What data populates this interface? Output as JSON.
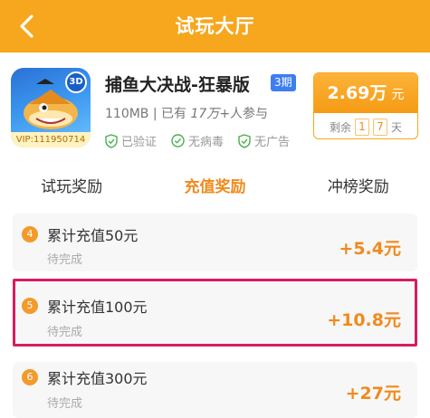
{
  "header": {
    "title": "试玩大厅",
    "back_icon": "chevron-left-icon"
  },
  "game": {
    "name": "捕鱼大决战-狂暴版",
    "phase": "3期",
    "vip": "VIP:111950714",
    "badge_3d": "3D",
    "size": "110MB",
    "divider": "|",
    "participants_prefix": "已有",
    "participants_count": "17万",
    "participants_suffix": "+人参与",
    "certs": [
      {
        "label": "已验证",
        "icon": "shield-check-icon"
      },
      {
        "label": "无病毒",
        "icon": "check-circle-icon"
      },
      {
        "label": "无广告",
        "icon": "shield-check-icon"
      }
    ]
  },
  "reward": {
    "amount": "2.69万",
    "unit": "元",
    "remaining_label": "剩余",
    "digit1": "1",
    "digit2": "7",
    "remaining_unit": "天"
  },
  "tabs": [
    {
      "label": "试玩奖励",
      "active": false
    },
    {
      "label": "充值奖励",
      "active": true
    },
    {
      "label": "冲榜奖励",
      "active": false
    }
  ],
  "tasks": [
    {
      "num": "4",
      "title": "累计充值50元",
      "status": "待完成",
      "reward": "+5.4元"
    },
    {
      "num": "5",
      "title": "累计充值100元",
      "status": "待完成",
      "reward": "+10.8元"
    },
    {
      "num": "6",
      "title": "累计充值300元",
      "status": "待完成",
      "reward": "+27元"
    }
  ],
  "colors": {
    "header": "#f6a71d",
    "accent": "#f08a1c",
    "highlight": "#d81b60",
    "phase_tag": "#3d7ff0"
  }
}
